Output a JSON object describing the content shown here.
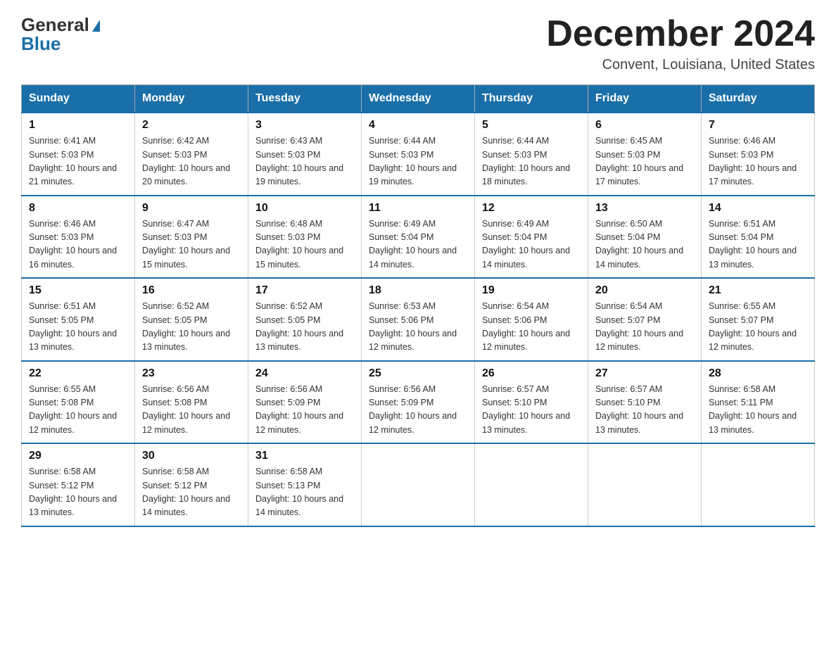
{
  "header": {
    "logo_general": "General",
    "logo_blue": "Blue",
    "month": "December 2024",
    "location": "Convent, Louisiana, United States"
  },
  "days_of_week": [
    "Sunday",
    "Monday",
    "Tuesday",
    "Wednesday",
    "Thursday",
    "Friday",
    "Saturday"
  ],
  "weeks": [
    [
      {
        "day": "1",
        "sunrise": "6:41 AM",
        "sunset": "5:03 PM",
        "daylight": "10 hours and 21 minutes."
      },
      {
        "day": "2",
        "sunrise": "6:42 AM",
        "sunset": "5:03 PM",
        "daylight": "10 hours and 20 minutes."
      },
      {
        "day": "3",
        "sunrise": "6:43 AM",
        "sunset": "5:03 PM",
        "daylight": "10 hours and 19 minutes."
      },
      {
        "day": "4",
        "sunrise": "6:44 AM",
        "sunset": "5:03 PM",
        "daylight": "10 hours and 19 minutes."
      },
      {
        "day": "5",
        "sunrise": "6:44 AM",
        "sunset": "5:03 PM",
        "daylight": "10 hours and 18 minutes."
      },
      {
        "day": "6",
        "sunrise": "6:45 AM",
        "sunset": "5:03 PM",
        "daylight": "10 hours and 17 minutes."
      },
      {
        "day": "7",
        "sunrise": "6:46 AM",
        "sunset": "5:03 PM",
        "daylight": "10 hours and 17 minutes."
      }
    ],
    [
      {
        "day": "8",
        "sunrise": "6:46 AM",
        "sunset": "5:03 PM",
        "daylight": "10 hours and 16 minutes."
      },
      {
        "day": "9",
        "sunrise": "6:47 AM",
        "sunset": "5:03 PM",
        "daylight": "10 hours and 15 minutes."
      },
      {
        "day": "10",
        "sunrise": "6:48 AM",
        "sunset": "5:03 PM",
        "daylight": "10 hours and 15 minutes."
      },
      {
        "day": "11",
        "sunrise": "6:49 AM",
        "sunset": "5:04 PM",
        "daylight": "10 hours and 14 minutes."
      },
      {
        "day": "12",
        "sunrise": "6:49 AM",
        "sunset": "5:04 PM",
        "daylight": "10 hours and 14 minutes."
      },
      {
        "day": "13",
        "sunrise": "6:50 AM",
        "sunset": "5:04 PM",
        "daylight": "10 hours and 14 minutes."
      },
      {
        "day": "14",
        "sunrise": "6:51 AM",
        "sunset": "5:04 PM",
        "daylight": "10 hours and 13 minutes."
      }
    ],
    [
      {
        "day": "15",
        "sunrise": "6:51 AM",
        "sunset": "5:05 PM",
        "daylight": "10 hours and 13 minutes."
      },
      {
        "day": "16",
        "sunrise": "6:52 AM",
        "sunset": "5:05 PM",
        "daylight": "10 hours and 13 minutes."
      },
      {
        "day": "17",
        "sunrise": "6:52 AM",
        "sunset": "5:05 PM",
        "daylight": "10 hours and 13 minutes."
      },
      {
        "day": "18",
        "sunrise": "6:53 AM",
        "sunset": "5:06 PM",
        "daylight": "10 hours and 12 minutes."
      },
      {
        "day": "19",
        "sunrise": "6:54 AM",
        "sunset": "5:06 PM",
        "daylight": "10 hours and 12 minutes."
      },
      {
        "day": "20",
        "sunrise": "6:54 AM",
        "sunset": "5:07 PM",
        "daylight": "10 hours and 12 minutes."
      },
      {
        "day": "21",
        "sunrise": "6:55 AM",
        "sunset": "5:07 PM",
        "daylight": "10 hours and 12 minutes."
      }
    ],
    [
      {
        "day": "22",
        "sunrise": "6:55 AM",
        "sunset": "5:08 PM",
        "daylight": "10 hours and 12 minutes."
      },
      {
        "day": "23",
        "sunrise": "6:56 AM",
        "sunset": "5:08 PM",
        "daylight": "10 hours and 12 minutes."
      },
      {
        "day": "24",
        "sunrise": "6:56 AM",
        "sunset": "5:09 PM",
        "daylight": "10 hours and 12 minutes."
      },
      {
        "day": "25",
        "sunrise": "6:56 AM",
        "sunset": "5:09 PM",
        "daylight": "10 hours and 12 minutes."
      },
      {
        "day": "26",
        "sunrise": "6:57 AM",
        "sunset": "5:10 PM",
        "daylight": "10 hours and 13 minutes."
      },
      {
        "day": "27",
        "sunrise": "6:57 AM",
        "sunset": "5:10 PM",
        "daylight": "10 hours and 13 minutes."
      },
      {
        "day": "28",
        "sunrise": "6:58 AM",
        "sunset": "5:11 PM",
        "daylight": "10 hours and 13 minutes."
      }
    ],
    [
      {
        "day": "29",
        "sunrise": "6:58 AM",
        "sunset": "5:12 PM",
        "daylight": "10 hours and 13 minutes."
      },
      {
        "day": "30",
        "sunrise": "6:58 AM",
        "sunset": "5:12 PM",
        "daylight": "10 hours and 14 minutes."
      },
      {
        "day": "31",
        "sunrise": "6:58 AM",
        "sunset": "5:13 PM",
        "daylight": "10 hours and 14 minutes."
      },
      null,
      null,
      null,
      null
    ]
  ]
}
